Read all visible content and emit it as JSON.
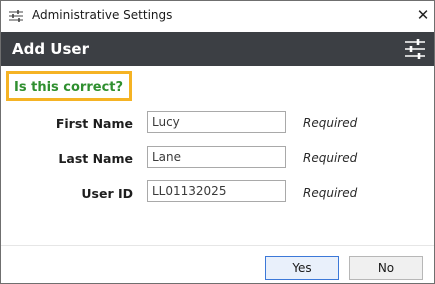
{
  "window": {
    "title": "Administrative Settings",
    "close_glyph": "✕"
  },
  "header": {
    "title": "Add User",
    "icon": "sliders-settings-icon"
  },
  "confirm_prompt": "Is this correct?",
  "fields": [
    {
      "label": "First Name",
      "value": "Lucy",
      "hint": "Required"
    },
    {
      "label": "Last Name",
      "value": "Lane",
      "hint": "Required"
    },
    {
      "label": "User ID",
      "value": "LL01132025",
      "hint": "Required"
    }
  ],
  "buttons": {
    "yes": "Yes",
    "no": "No"
  },
  "colors": {
    "header_bg": "#3c3f44",
    "highlight_border": "#f5b324",
    "prompt_text": "#2f8f2f",
    "primary_button_border": "#3c78d8"
  }
}
